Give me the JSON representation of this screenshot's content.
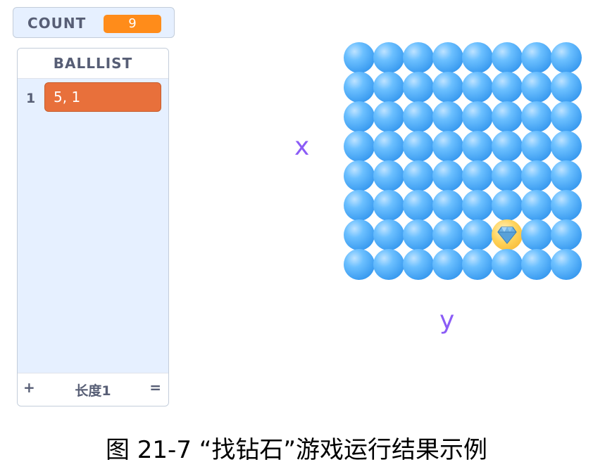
{
  "count_monitor": {
    "label": "COUNT",
    "value": "9"
  },
  "list_monitor": {
    "title": "BALLLIST",
    "items": [
      {
        "index": "1",
        "value": "5, 1"
      }
    ],
    "footer": {
      "add": "+",
      "length": "长度1",
      "resize": "="
    }
  },
  "stage": {
    "x_label": "x",
    "y_label": "y",
    "rows": 8,
    "cols": 8,
    "diamond_cell": {
      "row": 7,
      "col": 6
    }
  },
  "caption": "图 21-7 “找钻石”游戏运行结果示例"
}
